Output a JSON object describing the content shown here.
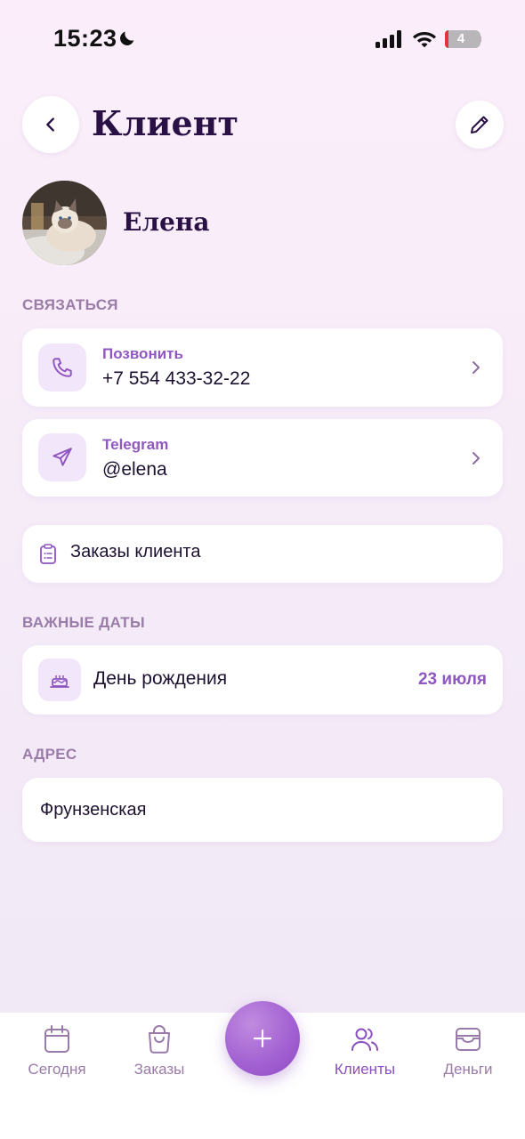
{
  "status_bar": {
    "time": "15:23",
    "battery": "4"
  },
  "header": {
    "title": "Клиент"
  },
  "client": {
    "name": "Елена"
  },
  "contact": {
    "section_label": "СВЯЗАТЬСЯ",
    "phone": {
      "label": "Позвонить",
      "value": "+7 554 433-32-22",
      "icon": "phone-icon"
    },
    "telegram": {
      "label": "Telegram",
      "value": "@elena",
      "icon": "send-icon"
    }
  },
  "orders": {
    "label": "Заказы клиента",
    "icon": "clipboard-icon"
  },
  "important_dates": {
    "section_label": "ВАЖНЫЕ ДАТЫ",
    "items": [
      {
        "label": "День рождения",
        "value": "23 июля",
        "icon": "cake-icon"
      }
    ]
  },
  "address": {
    "section_label": "АДРЕС",
    "value": "Фрунзенская"
  },
  "bottom_nav": {
    "items": [
      {
        "label": "Сегодня",
        "icon": "calendar-icon"
      },
      {
        "label": "Заказы",
        "icon": "bag-icon"
      },
      {
        "label": "Клиенты",
        "icon": "users-icon",
        "active": true
      },
      {
        "label": "Деньги",
        "icon": "wallet-icon"
      }
    ]
  },
  "colors": {
    "accent": "#9057c0",
    "title": "#2a1145",
    "section": "#9a7ca8",
    "icon_bg": "#f1e6fa"
  }
}
